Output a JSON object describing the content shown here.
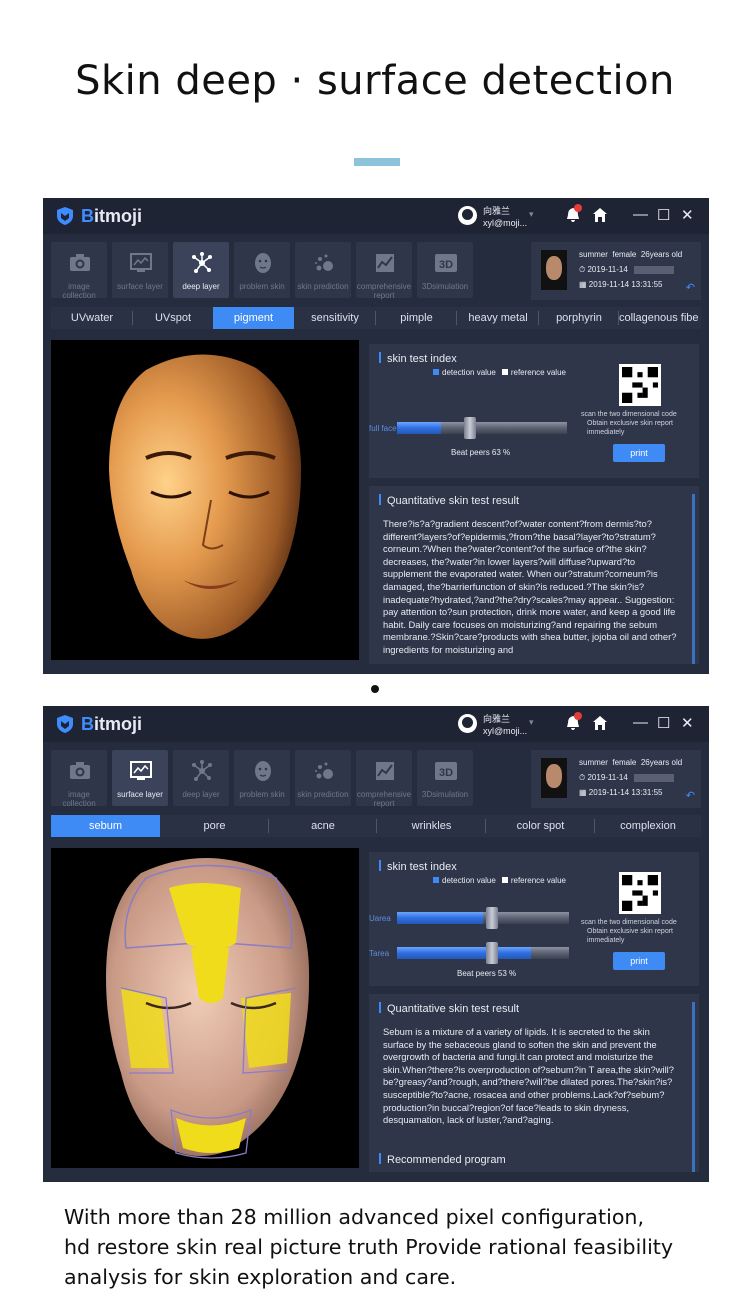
{
  "headline": "Skin deep · surface detection",
  "colors": {
    "accent": "#3e8bf6",
    "panel_bg": "#252c3d",
    "accent_bar": "#8cc3da"
  },
  "screens": [
    {
      "brand": "Bitmoji",
      "user": {
        "name": "向雅兰",
        "email": "xyl@moji..."
      },
      "window_controls": [
        "—",
        "☐",
        "✕"
      ],
      "tools": [
        {
          "label": "image collection",
          "icon": "camera-icon",
          "active": false
        },
        {
          "label": "surface layer",
          "icon": "monitor-chart-icon",
          "active": false
        },
        {
          "label": "deep layer",
          "icon": "molecule-icon",
          "active": true
        },
        {
          "label": "problem skin",
          "icon": "face-icon",
          "active": false
        },
        {
          "label": "skin prediction",
          "icon": "dots-icon",
          "active": false
        },
        {
          "label": "comprehensive report",
          "icon": "report-chart-icon",
          "active": false
        },
        {
          "label": "3Dsimulation",
          "icon": "3d-icon",
          "active": false
        }
      ],
      "profile": {
        "season": "summer",
        "gender": "female",
        "age": "26years old",
        "date": "2019-11-14",
        "datetime": "2019-11-14 13:31:55"
      },
      "tabs": [
        {
          "label": "UVwater",
          "active": false
        },
        {
          "label": "UVspot",
          "active": false
        },
        {
          "label": "pigment",
          "active": true
        },
        {
          "label": "sensitivity",
          "active": false
        },
        {
          "label": "pimple",
          "active": false
        },
        {
          "label": "heavy metal",
          "active": false
        },
        {
          "label": "porphyrin",
          "active": false
        },
        {
          "label": "collagenous fibe",
          "active": false
        }
      ],
      "index_panel": {
        "title": "skin test index",
        "legend": [
          "detection value",
          "reference value"
        ],
        "sliders": [
          {
            "label": "full face",
            "value_fraction": 0.26,
            "reference_fraction": 0.43
          }
        ],
        "beat_peers": "Beat peers 63 %",
        "qr_text": "scan the two dimensional code",
        "qr_sub": "Obtain exclusive skin report immediately",
        "print": "print"
      },
      "result": {
        "title": "Quantitative skin test result",
        "text": "There?is?a?gradient descent?of?water content?from dermis?to? different?layers?of?epidermis,?from?the basal?layer?to?stratum? corneum.?When the?water?content?of the surface of?the skin? decreases, the?water?in lower layers?will diffuse?upward?to supplement the evaporated water. When our?stratum?corneum?is damaged, the?barrierfunction of skin?is reduced.?The skin?is? inadequate?hydrated,?and?the?dry?scales?may appear.. Suggestion: pay attention to?sun protection, drink more water, and keep a good life habit. Daily care focuses on moisturizing?and repairing the sebum membrane.?Skin?care?products with shea butter, jojoba oil and other?ingredients for moisturizing and",
        "recommend": ""
      }
    },
    {
      "brand": "Bitmoji",
      "user": {
        "name": "向雅兰",
        "email": "xyl@moji..."
      },
      "window_controls": [
        "—",
        "☐",
        "✕"
      ],
      "tools": [
        {
          "label": "image collection",
          "icon": "camera-icon",
          "active": false
        },
        {
          "label": "surface layer",
          "icon": "monitor-chart-icon",
          "active": true
        },
        {
          "label": "deep layer",
          "icon": "molecule-icon",
          "active": false
        },
        {
          "label": "problem skin",
          "icon": "face-icon",
          "active": false
        },
        {
          "label": "skin prediction",
          "icon": "dots-icon",
          "active": false
        },
        {
          "label": "comprehensive report",
          "icon": "report-chart-icon",
          "active": false
        },
        {
          "label": "3Dsimulation",
          "icon": "3d-icon",
          "active": false
        }
      ],
      "profile": {
        "season": "summer",
        "gender": "female",
        "age": "26years old",
        "date": "2019-11-14",
        "datetime": "2019-11-14 13:31:55"
      },
      "tabs": [
        {
          "label": "sebum",
          "active": true
        },
        {
          "label": "pore",
          "active": false
        },
        {
          "label": "acne",
          "active": false
        },
        {
          "label": "wrinkles",
          "active": false
        },
        {
          "label": "color spot",
          "active": false
        },
        {
          "label": "complexion",
          "active": false
        }
      ],
      "index_panel": {
        "title": "skin test index",
        "legend": [
          "detection value",
          "reference value"
        ],
        "sliders": [
          {
            "label": "Uarea",
            "value_fraction": 0.5,
            "reference_fraction": 0.55
          },
          {
            "label": "Tarea",
            "value_fraction": 0.78,
            "reference_fraction": 0.55
          }
        ],
        "beat_peers": "Beat peers 53 %",
        "qr_text": "scan the two dimensional code",
        "qr_sub": "Obtain exclusive skin report immediately",
        "print": "print"
      },
      "result": {
        "title": "Quantitative skin test result",
        "text": "Sebum is a mixture of a variety of lipids. It is secreted to the skin surface by the sebaceous gland to soften the skin and prevent the overgrowth of bacteria and fungi.It can protect and moisturize the skin.When?there?is overproduction of?sebum?in T area,the skin?will?be?greasy?and?rough, and?there?will?be dilated pores.The?skin?is?susceptible?to?acne, rosacea and other problems.Lack?of?sebum?production?in buccal?region?of face?leads to skin dryness, desquamation, lack of luster,?and?aging.",
        "recommend": "Recommended program"
      }
    }
  ],
  "caption": [
    "With more than 28 million advanced pixel configuration,",
    "hd restore skin real picture truth Provide rational feasibility",
    "analysis for skin exploration and care."
  ]
}
